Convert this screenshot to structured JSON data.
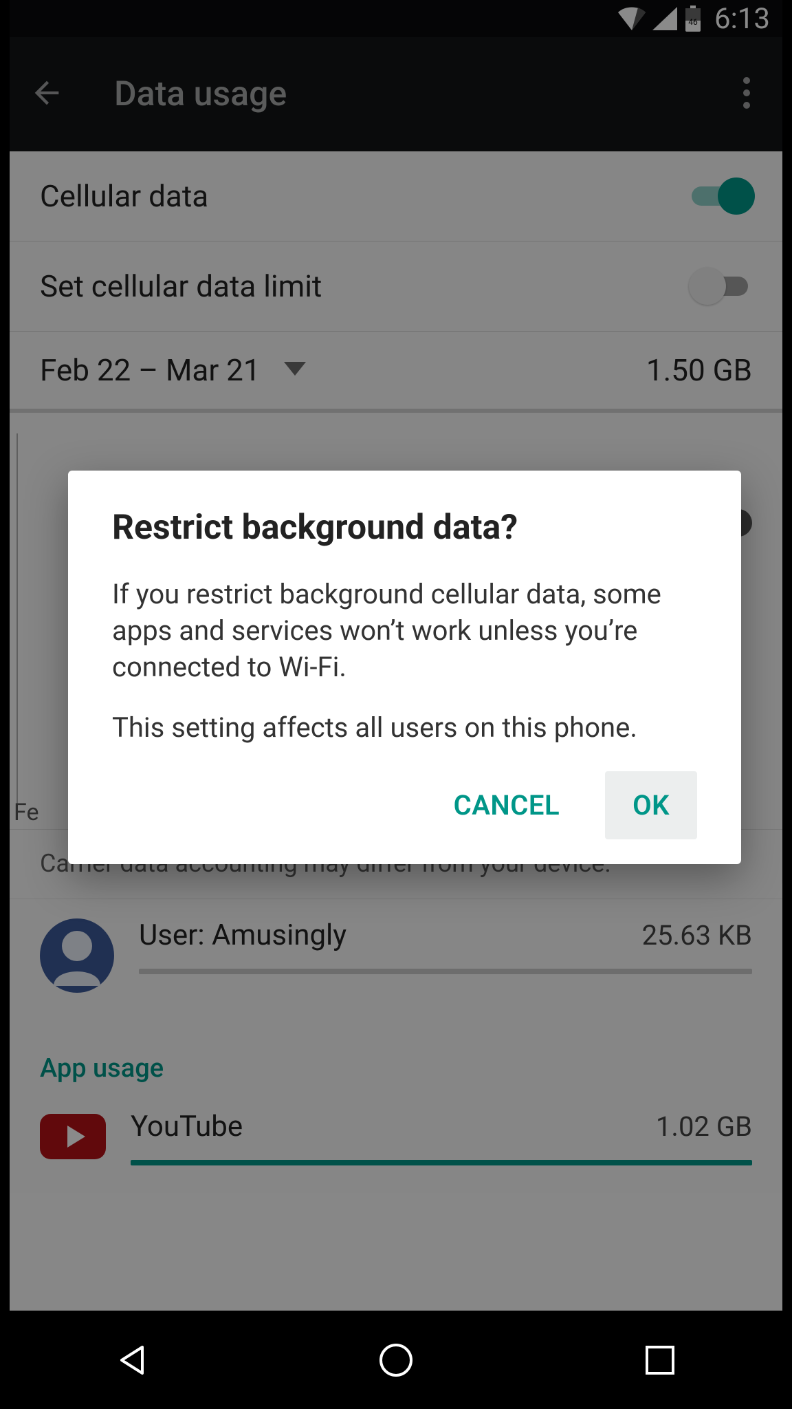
{
  "status": {
    "time": "6:13",
    "battery_text": "46"
  },
  "appbar": {
    "title": "Data usage"
  },
  "rows": {
    "cellular_data": {
      "label": "Cellular data",
      "on": true
    },
    "data_limit": {
      "label": "Set cellular data limit",
      "on": false
    }
  },
  "cycle": {
    "range": "Feb 22 – Mar 21",
    "total": "1.50 GB"
  },
  "chart_xlabel": "Fe",
  "carrier_note": "Carrier data accounting may differ from your device.",
  "user": {
    "label": "User: Amusingly",
    "usage": "25.63 KB"
  },
  "section_app_usage": "App usage",
  "apps": [
    {
      "name": "YouTube",
      "usage": "1.02 GB"
    }
  ],
  "dialog": {
    "title": "Restrict background data?",
    "body1": "If you restrict background cellular data, some apps and services won’t work unless you’re connected to Wi-Fi.",
    "body2": "This setting affects all users on this phone.",
    "cancel": "CANCEL",
    "ok": "OK"
  }
}
